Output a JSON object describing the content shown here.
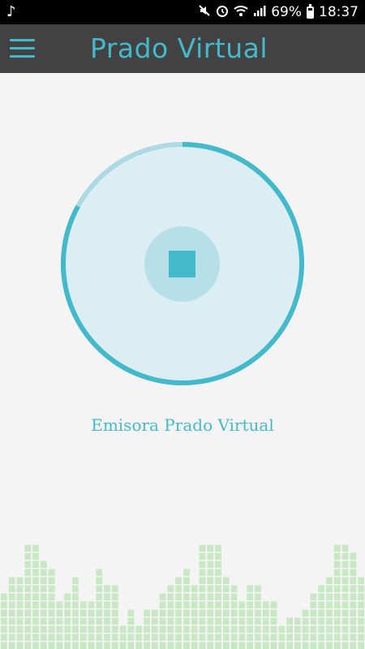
{
  "status_bar": {
    "music_icon": "music-note-icon",
    "battery_percent": "69%",
    "battery_level": 0.69,
    "time": "18:37",
    "icons": [
      "mute-icon",
      "alarm-icon",
      "wifi-icon",
      "signal-icon",
      "battery-icon"
    ]
  },
  "app_bar": {
    "title": "Prado Virtual",
    "menu_icon": "hamburger-menu-icon"
  },
  "player": {
    "progress": 0.83,
    "button_icon": "stop-icon",
    "station_name": "Emisora Prado Virtual"
  },
  "colors": {
    "accent": "#45b9cc",
    "accent_light": "#add9e3",
    "disc_fill": "#dbeef3",
    "app_bar": "#424242",
    "background": "#f4f4f4",
    "equalizer": "#c8e8c4"
  },
  "equalizer": {
    "segments_per_column": [
      7,
      9,
      9,
      13,
      13,
      11,
      10,
      6,
      7,
      9,
      6,
      6,
      10,
      8,
      8,
      3,
      5,
      3,
      5,
      5,
      7,
      8,
      9,
      10,
      8,
      13,
      13,
      13,
      9,
      8,
      6,
      8,
      8,
      6,
      6,
      3,
      4,
      4,
      5,
      7,
      8,
      9,
      13,
      13,
      12,
      9
    ]
  }
}
